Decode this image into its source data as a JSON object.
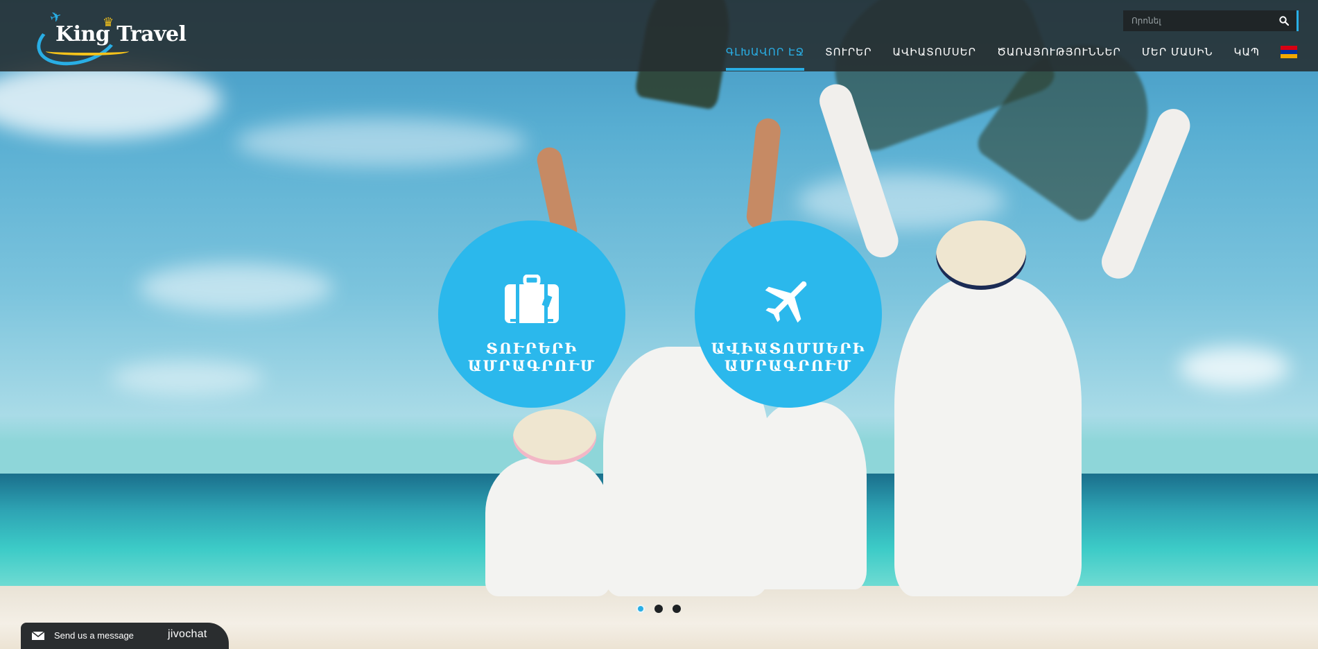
{
  "site": {
    "logo_text": "King Travel"
  },
  "search": {
    "placeholder": "Որոնել"
  },
  "nav": {
    "items": [
      {
        "label": "ԳԼԽԱՎՈՐ ԷՋ",
        "active": true
      },
      {
        "label": "ՏՈՒՐԵՐ",
        "active": false
      },
      {
        "label": "ԱՎԻԱՏՈՄՍԵՐ",
        "active": false
      },
      {
        "label": "ԾԱՌԱՅՈՒԹՅՈՒՆՆԵՐ",
        "active": false
      },
      {
        "label": "ՄԵՐ ՄԱՍԻՆ",
        "active": false
      },
      {
        "label": "ԿԱՊ",
        "active": false
      }
    ],
    "language_flag": {
      "icon": "armenia-flag-icon",
      "colors": [
        "#d90012",
        "#0033a0",
        "#f2a800"
      ]
    }
  },
  "hero": {
    "cards": [
      {
        "icon": "suitcase-icon",
        "line1": "ՏՈՒՐԵՐԻ",
        "line2": "ԱՄՐԱԳՐՈՒՄ"
      },
      {
        "icon": "airplane-icon",
        "line1": "ԱՎԻԱՏՈՄՍԵՐԻ",
        "line2": "ԱՄՐԱԳՐՈՒՄ"
      }
    ],
    "slides": {
      "total": 3,
      "active": 1
    }
  },
  "chat": {
    "message": "Send us a message",
    "brand": "jivochat"
  },
  "colors": {
    "accent": "#29aee5",
    "circle": "#2bb8ec",
    "header_bg": "#262e30"
  }
}
